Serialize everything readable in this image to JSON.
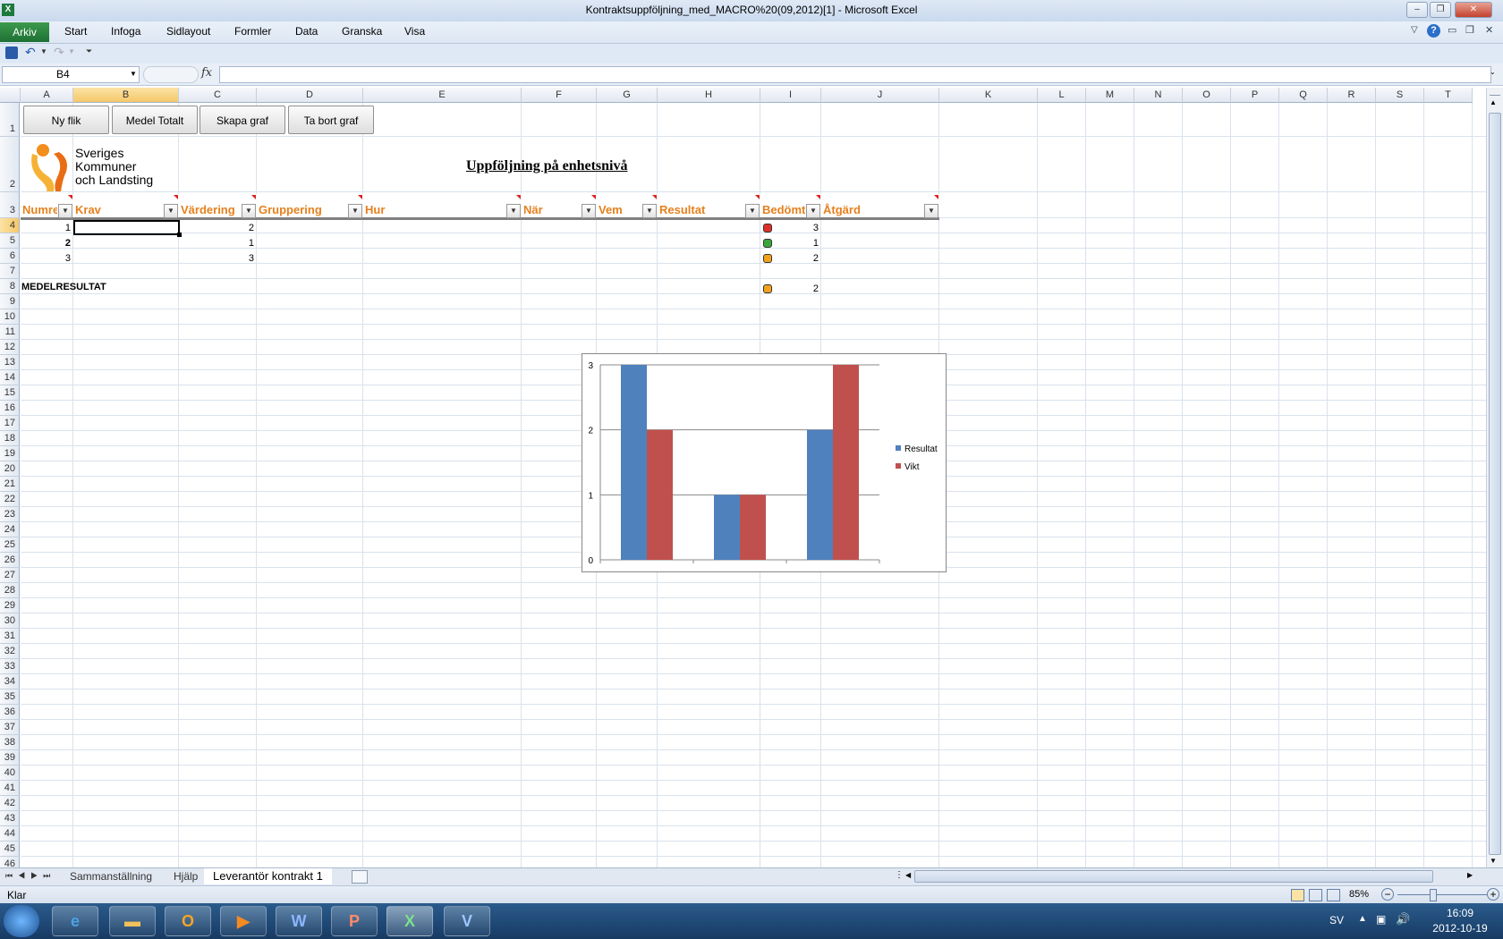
{
  "window": {
    "title": "Kontraktsuppföljning_med_MACRO%20(09,2012)[1]  -  Microsoft Excel"
  },
  "ribbon": {
    "file_tab": "Arkiv",
    "tabs": [
      "Start",
      "Infoga",
      "Sidlayout",
      "Formler",
      "Data",
      "Granska",
      "Visa"
    ]
  },
  "formula_bar": {
    "name_box": "B4",
    "fx": "fx",
    "value": ""
  },
  "columns": [
    "A",
    "B",
    "C",
    "D",
    "E",
    "F",
    "G",
    "H",
    "I",
    "J",
    "K",
    "L",
    "M",
    "N",
    "O",
    "P",
    "Q",
    "R",
    "S",
    "T"
  ],
  "selected_cell": "B4",
  "buttons": [
    "Ny flik",
    "Medel Totalt",
    "Skapa graf",
    "Ta bort graf"
  ],
  "logo": {
    "line1": "Sveriges",
    "line2": "Kommuner",
    "line3": "och Landsting"
  },
  "sheet_title": "Uppföljning på enhetsnivå",
  "table": {
    "headers": [
      "Numre",
      "Krav",
      "Värdering",
      "Gruppering",
      "Hur",
      "När",
      "Vem",
      "Resultat",
      "Bedömt",
      "Åtgärd"
    ],
    "rows": [
      {
        "numre": "1",
        "vardering": "2",
        "status": "red",
        "bedomt": "3"
      },
      {
        "numre": "2",
        "vardering": "1",
        "status": "green",
        "bedomt": "1"
      },
      {
        "numre": "3",
        "vardering": "3",
        "status": "orange",
        "bedomt": "2"
      }
    ],
    "summary": {
      "label": "MEDELRESULTAT",
      "status": "orange",
      "bedomt": "2"
    }
  },
  "status_colors": {
    "red": "#e0302a",
    "green": "#3aa63a",
    "orange": "#f4a21c"
  },
  "chart_data": {
    "type": "bar",
    "categories": [
      "",
      "",
      ""
    ],
    "series": [
      {
        "name": "Resultat",
        "values": [
          3,
          1,
          2
        ],
        "color": "#4f81bd"
      },
      {
        "name": "Vikt",
        "values": [
          2,
          1,
          3
        ],
        "color": "#c0504d"
      }
    ],
    "ylim": [
      0,
      3
    ],
    "yticks": [
      "0",
      "1",
      "2",
      "3"
    ],
    "grid": true,
    "legend": "right"
  },
  "sheet_tabs": [
    "Sammanställning",
    "Hjälp",
    "Leverantör kontrakt 1"
  ],
  "status_bar": {
    "ready": "Klar",
    "zoom": "85%"
  },
  "taskbar": {
    "lang": "SV",
    "time": "16:09",
    "date": "2012-10-19"
  }
}
